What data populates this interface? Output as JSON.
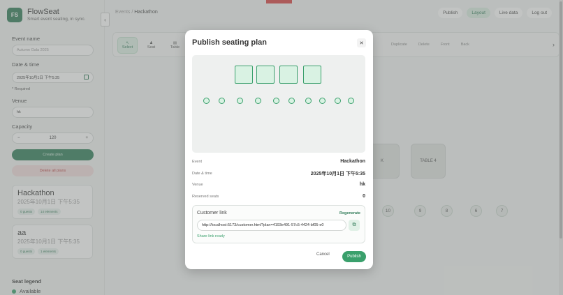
{
  "app": {
    "brand": "FlowSeat",
    "logo_initials": "FS",
    "tagline": "Smart event seating, in sync."
  },
  "form": {
    "event_name_label": "Event name",
    "event_name_placeholder": "Autumn Gala 2025",
    "date_label": "Date & time",
    "date_value": "2025年10月1日 下午5:35",
    "required_note": "* Required",
    "venue_label": "Venue",
    "venue_value": "hk",
    "capacity_label": "Capacity",
    "capacity_value": "120",
    "minus": "−",
    "plus": "+",
    "create_button": "Create plan",
    "delete_all_button": "Delete all plans"
  },
  "plans": [
    {
      "title": "Hackathon",
      "date": "2025年10月1日 下午5:35",
      "guests": "0 guests",
      "elements": "14 elements"
    },
    {
      "title": "aa",
      "date": "2025年10月1日 下午5:35",
      "guests": "0 guests",
      "elements": "1 elements"
    }
  ],
  "legend": {
    "title": "Seat legend",
    "available": "Available"
  },
  "breadcrumb": {
    "parent": "Events",
    "separator": "/",
    "current": "Hackathon"
  },
  "top_buttons": [
    "Publish",
    "Layout",
    "Live data",
    "Log out"
  ],
  "toolbar": {
    "tools": [
      {
        "label": "Select",
        "icon": "↖"
      },
      {
        "label": "Seat",
        "icon": "♟"
      },
      {
        "label": "Table",
        "icon": "▤"
      }
    ],
    "right_tools": [
      "Duplicate",
      "Delete",
      "Front",
      "Back"
    ],
    "chevron": "›"
  },
  "canvas": {
    "table_k": "K",
    "table_4": "TABLE 4",
    "seats": [
      "10",
      "9",
      "8",
      "6",
      "7"
    ]
  },
  "modal": {
    "title": "Publish seating plan",
    "close": "✕",
    "details": [
      {
        "key": "Event",
        "value": "Hackathon"
      },
      {
        "key": "Date & time",
        "value": "2025年10月1日 下午5:35"
      },
      {
        "key": "Venue",
        "value": "hk"
      },
      {
        "key": "Reserved seats",
        "value": "0"
      }
    ],
    "customer_link_label": "Customer link",
    "regenerate": "Regenerate",
    "url": "http://localhost:5173/customer.html?plan=4193e491-57c5-4424-bf05-e0",
    "share_status": "Share link ready",
    "cancel": "Cancel",
    "publish": "Publish"
  },
  "colors": {
    "accent": "#3aa06c",
    "brand": "#2f7a57",
    "danger": "#d74040"
  }
}
